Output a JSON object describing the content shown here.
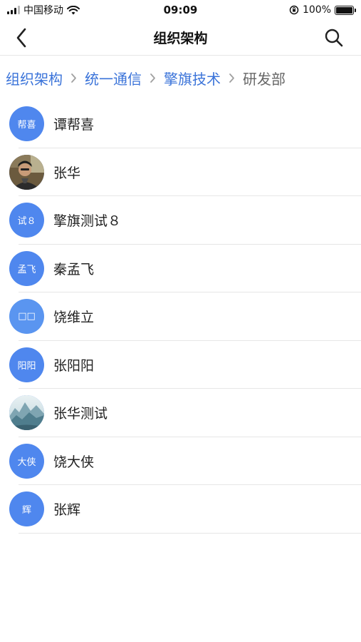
{
  "status_bar": {
    "carrier": "中国移动",
    "time": "09:09",
    "battery": "100%"
  },
  "nav": {
    "title": "组织架构",
    "back_icon": "chevron-left-icon",
    "search_icon": "search-icon"
  },
  "breadcrumb": [
    {
      "label": "组织架构"
    },
    {
      "label": "统一通信"
    },
    {
      "label": "擎旗技术"
    },
    {
      "label": "研发部"
    }
  ],
  "members": [
    {
      "name": "谭帮喜",
      "avatar_text": "帮喜"
    },
    {
      "name": "张华",
      "avatar_text": ""
    },
    {
      "name": "擎旗测试８",
      "avatar_text": "试８"
    },
    {
      "name": "秦孟飞",
      "avatar_text": "孟飞"
    },
    {
      "name": "饶维立",
      "avatar_text": "□□"
    },
    {
      "name": "张阳阳",
      "avatar_text": "阳阳"
    },
    {
      "name": "张华测试",
      "avatar_text": ""
    },
    {
      "name": "饶大侠",
      "avatar_text": "大侠"
    },
    {
      "name": "张辉",
      "avatar_text": "辉"
    }
  ],
  "colors": {
    "accent": "#3a73d9",
    "avatar_bg": "#4f87ee"
  }
}
